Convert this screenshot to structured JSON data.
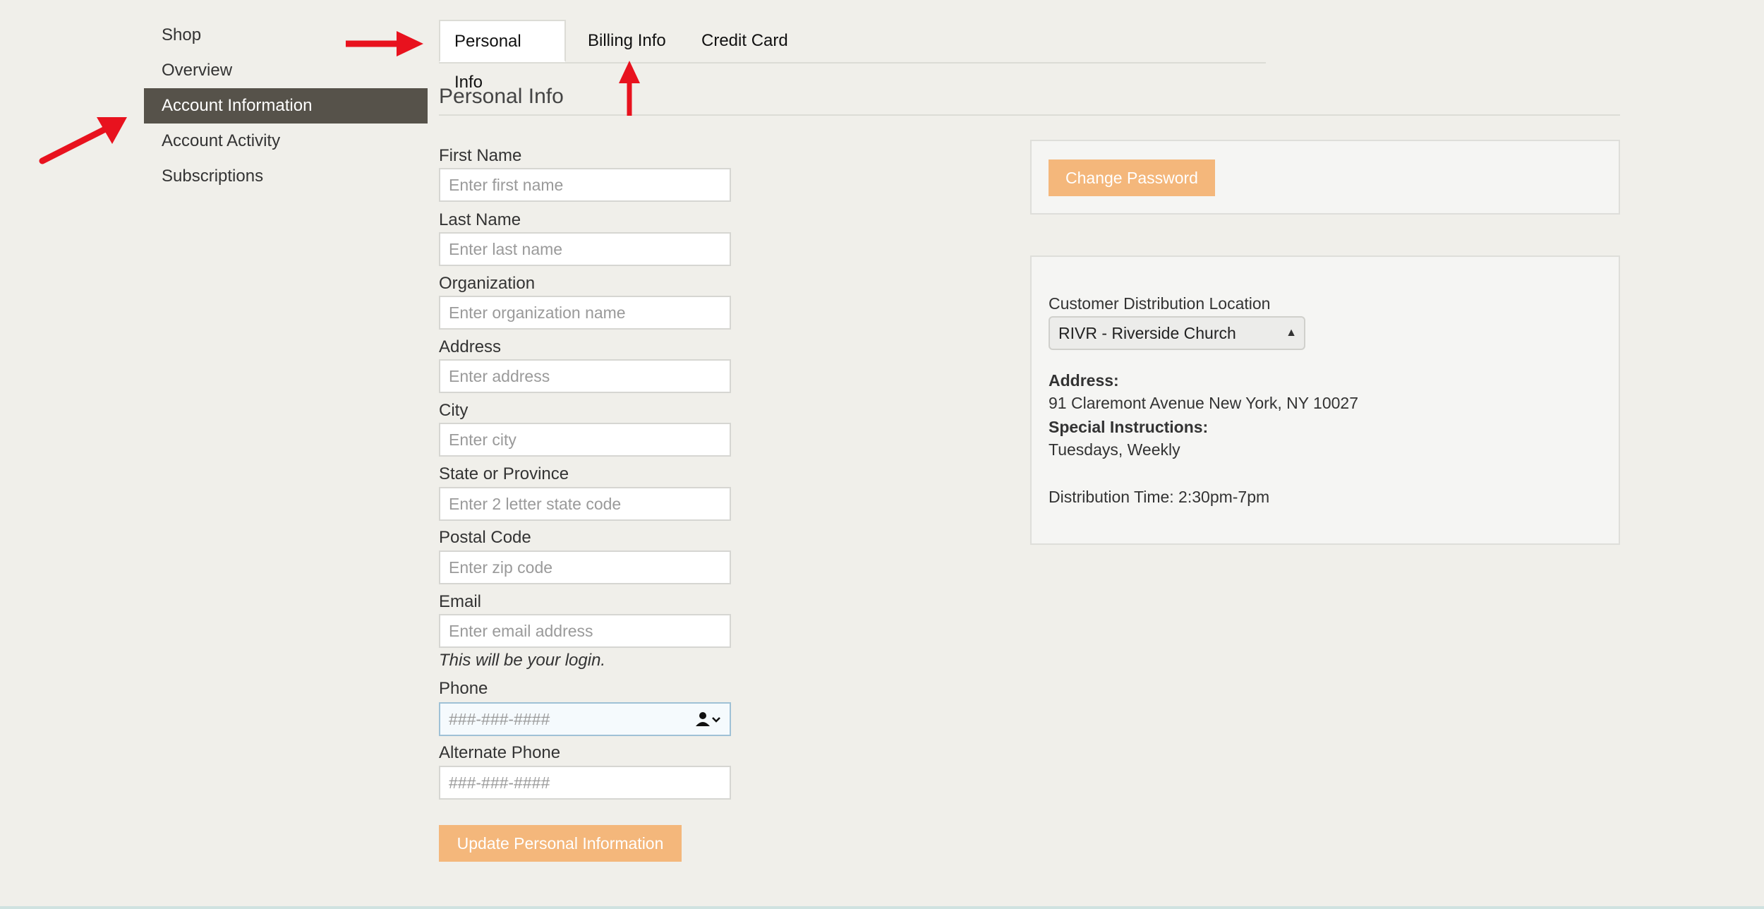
{
  "sidebar": {
    "items": [
      {
        "label": "Shop"
      },
      {
        "label": "Overview"
      },
      {
        "label": "Account Information"
      },
      {
        "label": "Account Activity"
      },
      {
        "label": "Subscriptions"
      }
    ]
  },
  "tabs": [
    {
      "label": "Personal Info"
    },
    {
      "label": "Billing Info"
    },
    {
      "label": "Credit Card"
    }
  ],
  "section_title": "Personal Info",
  "form": {
    "first_name": {
      "label": "First Name",
      "placeholder": "Enter first name"
    },
    "last_name": {
      "label": "Last Name",
      "placeholder": "Enter last name"
    },
    "organization": {
      "label": "Organization",
      "placeholder": "Enter organization name"
    },
    "address": {
      "label": "Address",
      "placeholder": "Enter address"
    },
    "city": {
      "label": "City",
      "placeholder": "Enter city"
    },
    "state": {
      "label": "State or Province",
      "placeholder": "Enter 2 letter state code"
    },
    "postal": {
      "label": "Postal Code",
      "placeholder": "Enter zip code"
    },
    "email": {
      "label": "Email",
      "placeholder": "Enter email address",
      "hint": "This will be your login."
    },
    "phone": {
      "label": "Phone",
      "placeholder": "###-###-####"
    },
    "alt_phone": {
      "label": "Alternate Phone",
      "placeholder": "###-###-####"
    },
    "submit_label": "Update Personal Information"
  },
  "password_panel": {
    "button_label": "Change Password"
  },
  "location_panel": {
    "label": "Customer Distribution Location",
    "selected": "RIVR - Riverside Church",
    "address_label": "Address:",
    "address_value": "91 Claremont Avenue New York, NY 10027",
    "instructions_label": "Special Instructions:",
    "instructions_value": "Tuesdays, Weekly",
    "distribution_time": "Distribution Time: 2:30pm-7pm"
  },
  "colors": {
    "accent": "#f4b77b",
    "sidebar_active": "#56524a",
    "annotation_arrow": "#e8121e"
  }
}
